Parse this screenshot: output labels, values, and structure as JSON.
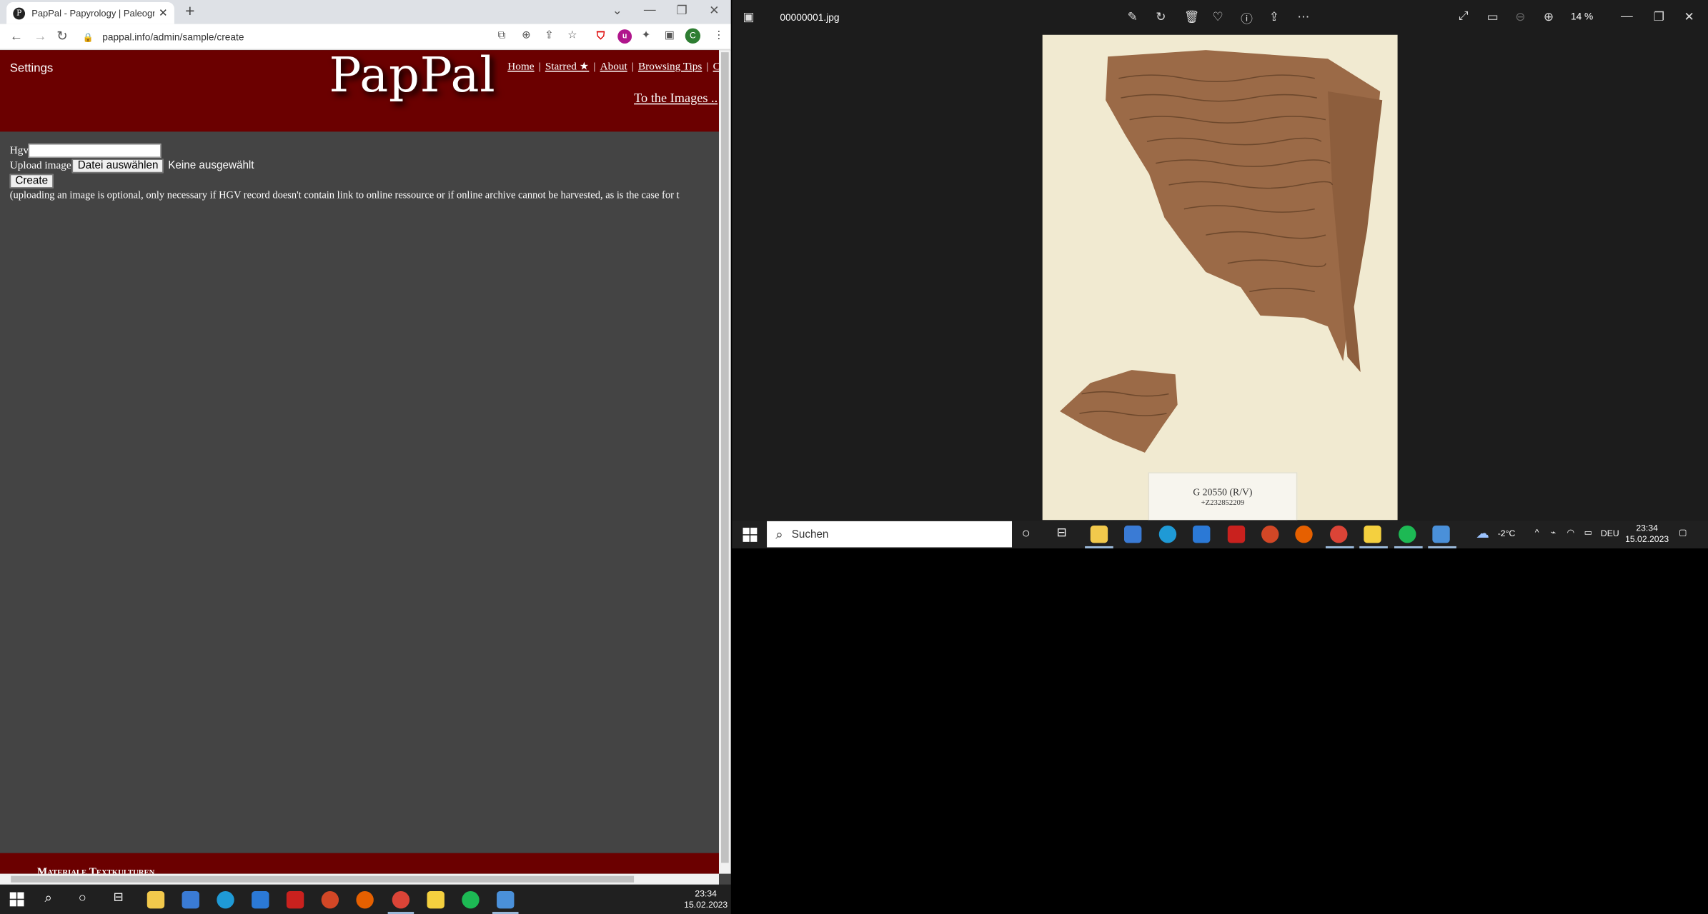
{
  "browser": {
    "tab_title": "PapPal - Papyrology | Paleography",
    "url": "pappal.info/admin/sample/create"
  },
  "site": {
    "settings_label": "Settings",
    "logo": "PapPal",
    "nav": [
      "Home",
      "Starred ★",
      "About",
      "Browsing Tips",
      "C"
    ],
    "to_images": "To the Images ..",
    "footer_text": "Materiale Textkulturen"
  },
  "form": {
    "hgv_label": "Hgv",
    "hgv_value": "",
    "upload_label": "Upload image",
    "file_button": "Datei auswählen",
    "file_status": "Keine ausgewählt",
    "create_button": "Create",
    "note": "(uploading an image is optional, only necessary if HGV record doesn't contain link to online ressource or if online archive cannot be harvested, as is the case for t"
  },
  "viewer": {
    "filename": "00000001.jpg",
    "zoom": "14 %",
    "label_main": "G 20550 (R/V)",
    "label_sub": "+Z232852209"
  },
  "taskbar_right": {
    "search_placeholder": "Suchen",
    "weather": "-2°C",
    "lang": "DEU",
    "time": "23:34",
    "date": "15.02.2023"
  },
  "taskbar_left": {
    "time": "23:34",
    "date": "15.02.2023"
  },
  "colors": {
    "header_red": "#6b0000",
    "page_bg": "#444444",
    "viewer_bg": "#1c1c1c"
  }
}
